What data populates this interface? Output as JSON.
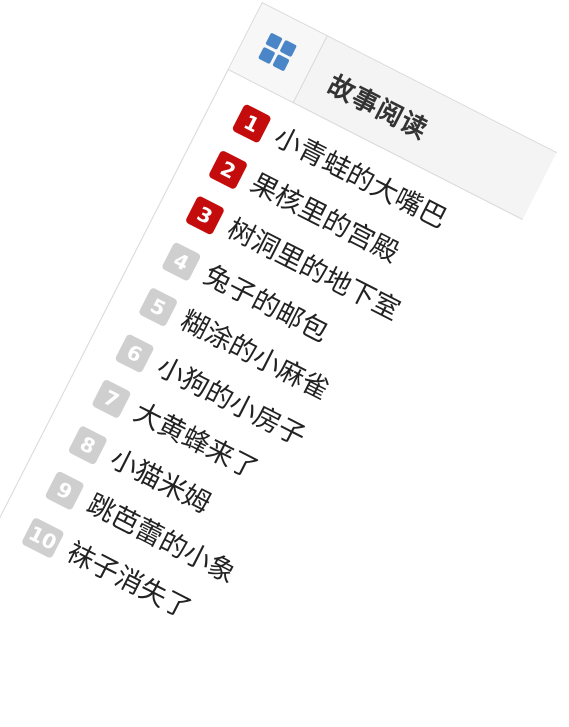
{
  "header": {
    "title": "故事阅读",
    "icon": "grid-icon"
  },
  "colors": {
    "top_rank_badge": "#c40c0c",
    "normal_rank_badge": "#cfcfcf",
    "icon_blue": "#4a86c7",
    "header_background": "#f4f4f4"
  },
  "stories": [
    {
      "rank": "1",
      "title": "小青蛙的大嘴巴"
    },
    {
      "rank": "2",
      "title": "果核里的宫殿"
    },
    {
      "rank": "3",
      "title": "树洞里的地下室"
    },
    {
      "rank": "4",
      "title": "兔子的邮包"
    },
    {
      "rank": "5",
      "title": "糊涂的小麻雀"
    },
    {
      "rank": "6",
      "title": "小狗的小房子"
    },
    {
      "rank": "7",
      "title": "大黄蜂来了"
    },
    {
      "rank": "8",
      "title": "小猫米姆"
    },
    {
      "rank": "9",
      "title": "跳芭蕾的小象"
    },
    {
      "rank": "10",
      "title": "袜子消失了"
    }
  ]
}
